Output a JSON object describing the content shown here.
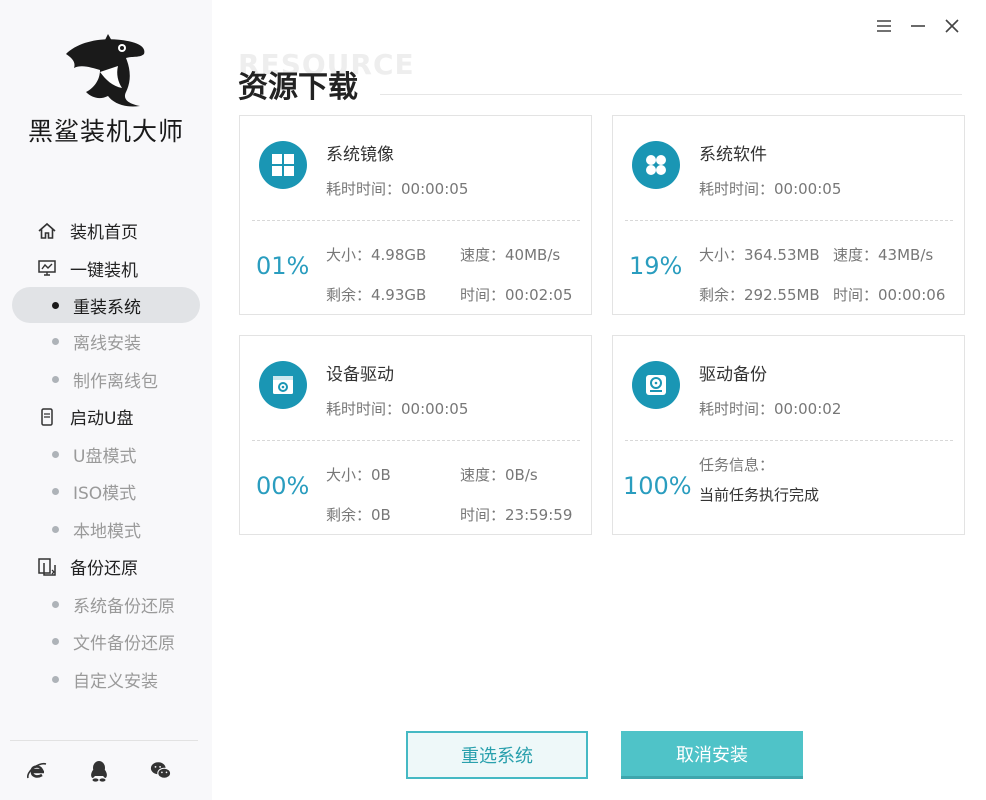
{
  "app": {
    "brand": "黑鲨装机大师"
  },
  "sidebar": {
    "groups": [
      {
        "label": "装机首页",
        "icon": "home-icon"
      },
      {
        "label": "一键装机",
        "icon": "monitor-icon"
      },
      {
        "label": "启动U盘",
        "icon": "usb-icon"
      },
      {
        "label": "备份还原",
        "icon": "backup-icon"
      }
    ],
    "subitems": {
      "reinstall": "重装系统",
      "offline_install": "离线安装",
      "make_offline": "制作离线包",
      "usb_mode": "U盘模式",
      "iso_mode": "ISO模式",
      "local_mode": "本地模式",
      "system_backup": "系统备份还原",
      "file_backup": "文件备份还原",
      "custom_install": "自定义安装"
    },
    "active": "重装系统",
    "footer_icons": [
      "ie-icon",
      "qq-icon",
      "wechat-icon"
    ]
  },
  "window_controls": [
    "menu-icon",
    "minimize-icon",
    "close-icon"
  ],
  "header": {
    "ghost_text": "RESOURCE",
    "title": "资源下载"
  },
  "cards": [
    {
      "name": "系统镜像",
      "icon": "windows-icon",
      "elapsed": "耗时时间：00:00:05",
      "percent": "01%",
      "size": "大小：4.98GB",
      "speed": "速度：40MB/s",
      "remaining": "剩余：4.93GB",
      "time": "时间：00:02:05"
    },
    {
      "name": "系统软件",
      "icon": "apps-icon",
      "elapsed": "耗时时间：00:00:05",
      "percent": "19%",
      "size": "大小：364.53MB",
      "speed": "速度：43MB/s",
      "remaining": "剩余：292.55MB",
      "time": "时间：00:00:06"
    },
    {
      "name": "设备驱动",
      "icon": "driver-icon",
      "elapsed": "耗时时间：00:00:05",
      "percent": "00%",
      "size": "大小：0B",
      "speed": "速度：0B/s",
      "remaining": "剩余：0B",
      "time": "时间：23:59:59"
    },
    {
      "name": "驱动备份",
      "icon": "disk-icon",
      "elapsed": "耗时时间：00:00:02",
      "percent": "100%",
      "info_label": "任务信息：",
      "info_value": "当前任务执行完成"
    }
  ],
  "buttons": {
    "reselect": "重选系统",
    "cancel": "取消安装"
  },
  "colors": {
    "accent": "#1a96b4",
    "percent": "#2a9dbf",
    "button": "#4fc3c8",
    "sidebar_bg": "#f8f8fa"
  }
}
